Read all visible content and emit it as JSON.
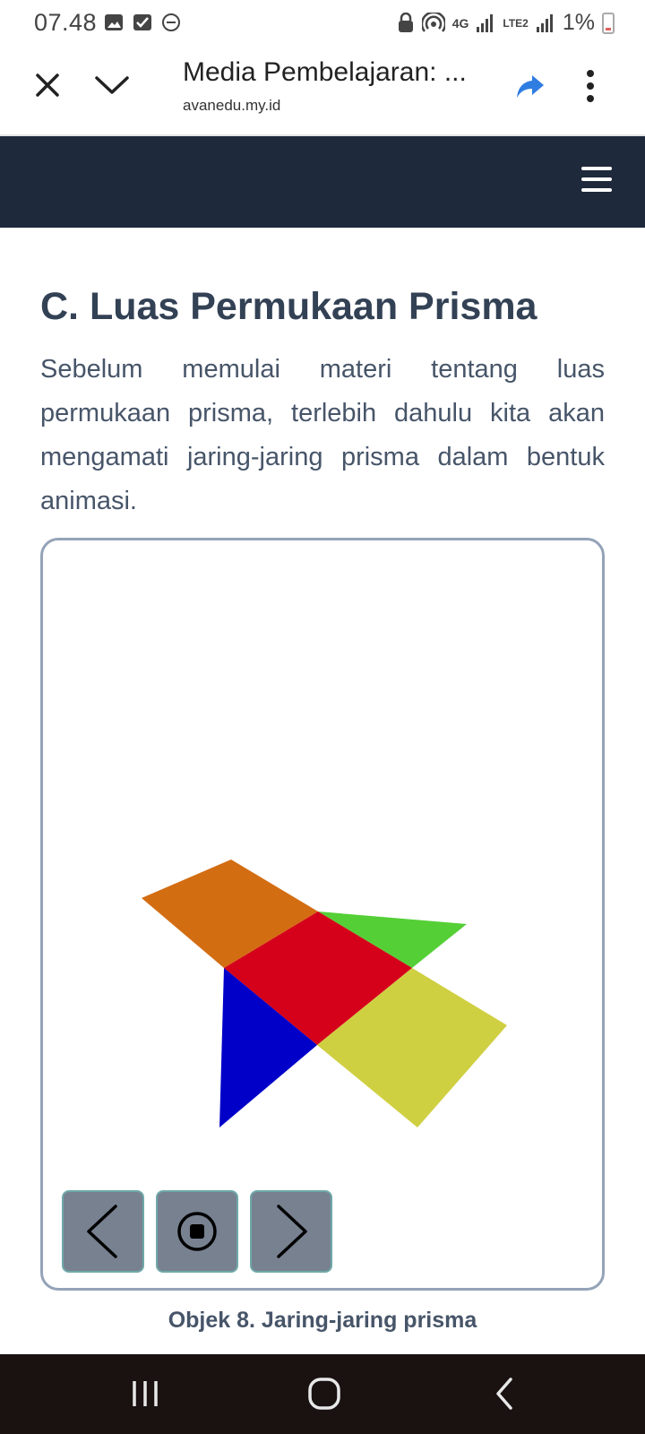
{
  "status_bar": {
    "time": "07.48",
    "network": "4G",
    "lte_label": "LTE2",
    "battery": "1%",
    "left_icons": [
      "image-icon",
      "checkbox-icon",
      "do-not-disturb-icon"
    ],
    "right_icons": [
      "lock-icon",
      "hotspot-icon",
      "signal-icon",
      "signal-icon"
    ]
  },
  "browser": {
    "title": "Media Pembelajaran: ...",
    "domain": "avanedu.my.id",
    "icons": {
      "close": "close-icon",
      "collapse": "chevron-down-icon",
      "share": "share-icon",
      "more": "more-vertical-icon"
    },
    "accent_color": "#2f7de1"
  },
  "site_nav": {
    "menu_icon": "hamburger-menu-icon",
    "background": "#1e293b"
  },
  "content": {
    "title": "C. Luas Permukaan Prisma",
    "paragraph": "Sebelum memulai materi tentang luas permukaan prisma, terlebih dahulu kita akan mengamati jaring-jaring prisma dalam bentuk animasi.",
    "figure": {
      "net_colors": {
        "top_face": "#d36d12",
        "side_triangle_right": "#55cf36",
        "center_face": "#d5001a",
        "side_triangle_left": "#0000c8",
        "bottom_face": "#cfcf42"
      },
      "controls": [
        {
          "name": "previous-button",
          "icon": "chevron-left-icon"
        },
        {
          "name": "stop-button",
          "icon": "stop-icon"
        },
        {
          "name": "next-button",
          "icon": "chevron-right-icon"
        }
      ],
      "caption": "Objek 8. Jaring-jaring prisma"
    }
  },
  "nav_bar": {
    "buttons": [
      "recent-apps-icon",
      "home-icon",
      "back-icon"
    ]
  }
}
